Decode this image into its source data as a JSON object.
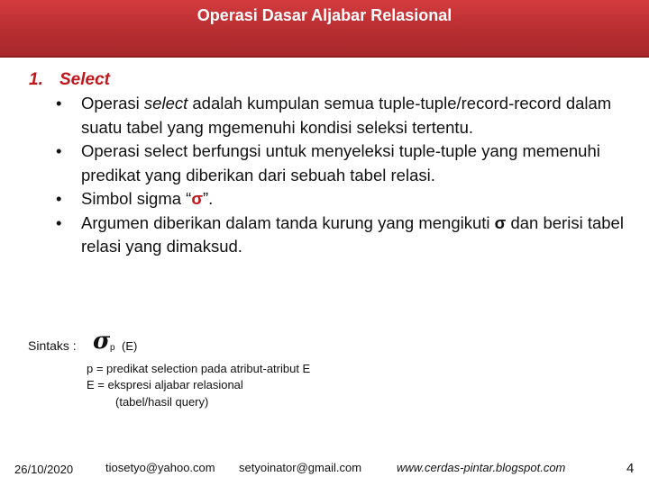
{
  "header": {
    "title": "Operasi Dasar Aljabar Relasional",
    "background_color": "#c2312f"
  },
  "section": {
    "number": "1.",
    "title": "Select",
    "accent_color": "#c0161c"
  },
  "bullets": [
    {
      "parts": [
        "Operasi ",
        "select",
        " adalah kumpulan semua tuple-tuple/record-record dalam suatu tabel yang mgemenuhi kondisi seleksi tertentu."
      ]
    },
    {
      "text": "Operasi select berfungsi untuk menyeleksi tuple-tuple yang memenuhi predikat yang diberikan dari sebuah tabel relasi."
    },
    {
      "prefix": "Simbol sigma “",
      "symbol": "σ",
      "suffix": "”."
    },
    {
      "prefix": "Argumen diberikan dalam tanda kurung yang mengikuti ",
      "symbol": "σ",
      "suffix": " dan berisi tabel relasi yang dimaksud."
    }
  ],
  "syntax": {
    "label": "Sintaks :",
    "sigma": "σ",
    "subscript": "p",
    "argument": "(E)",
    "definitions": [
      "p  = predikat selection pada atribut-atribut E",
      "E  = ekspresi aljabar relasional",
      "(tabel/hasil query)"
    ]
  },
  "footer": {
    "date": "26/10/2020",
    "email1": "tiosetyo@yahoo.com",
    "email2": "setyoinator@gmail.com",
    "website": "www.cerdas-pintar.blogspot.com",
    "page_number": "4"
  }
}
